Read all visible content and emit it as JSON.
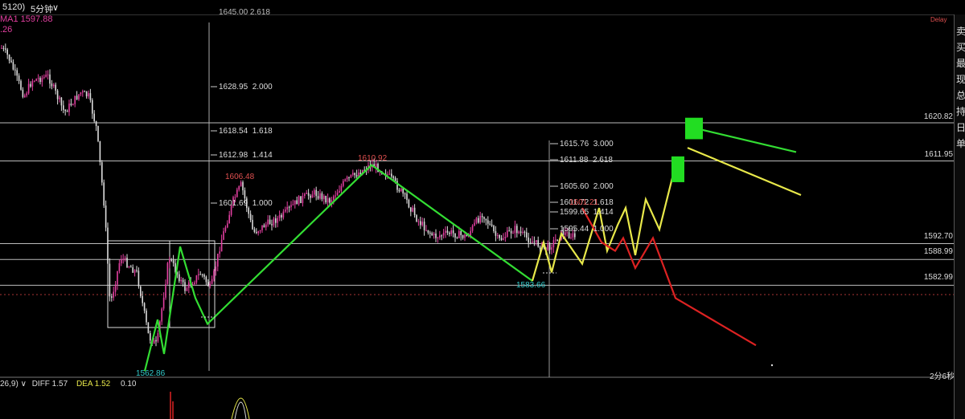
{
  "topbar": {
    "period_code": "5120)",
    "timeframe": "5分钟",
    "ma_label": "MA1 1597.88",
    "ma_label2": ".26"
  },
  "status": {
    "delay": "Delay",
    "timer": "2分6秒"
  },
  "right_panel": {
    "tabs": [
      "卖",
      "买",
      "最",
      "现",
      "总",
      "持",
      "日",
      "单"
    ]
  },
  "price_levels": [
    "1620.82",
    "1611.95",
    "1592.70",
    "1588.99",
    "1582.99"
  ],
  "fib_left": [
    {
      "price": "1628.95",
      "ratio": "2.000"
    },
    {
      "price": "1618.54",
      "ratio": "1.618"
    },
    {
      "price": "1612.98",
      "ratio": "1.414"
    },
    {
      "price": "1601.69",
      "ratio": "1.000"
    }
  ],
  "fib_right": [
    {
      "price": "1615.76",
      "ratio": "3.000"
    },
    {
      "price": "1611.88",
      "ratio": "2.618"
    },
    {
      "price": "1605.60",
      "ratio": "2.000"
    },
    {
      "price": "1601.72",
      "ratio": "1.618"
    },
    {
      "price": "1599.65",
      "ratio": "1.414"
    },
    {
      "price": "1595.44",
      "ratio": "1.000"
    }
  ],
  "fib_top_partial": "1645.00  2.618",
  "peak_labels": {
    "low1": "1562.86",
    "high1": "1606.48",
    "high2": "1610.92",
    "low2": "1583.66",
    "high3": "1601.21"
  },
  "macd": {
    "params": "26,9)",
    "diff_label": "DIFF 1.57",
    "dea_label": "DEA 1.52",
    "value": "0.10"
  },
  "chart_data": {
    "type": "line",
    "title": "",
    "xlabel": "",
    "ylabel": "",
    "ylim": [
      1556,
      1650
    ],
    "horizontal_levels": [
      1620.82,
      1611.95,
      1592.7,
      1588.99,
      1582.99
    ],
    "series": [
      {
        "color": "#33dd33",
        "points": [
          [
            0,
            1563
          ],
          [
            1,
            1575
          ],
          [
            2,
            1567
          ],
          [
            3,
            1592
          ],
          [
            4,
            1580
          ],
          [
            5,
            1574
          ],
          [
            6,
            1611
          ],
          [
            7,
            1584
          ]
        ]
      },
      {
        "color": "#e8e84a",
        "points": [
          [
            7,
            1584
          ],
          [
            8,
            1593
          ],
          [
            9,
            1586
          ],
          [
            10,
            1595
          ],
          [
            11,
            1588
          ],
          [
            12,
            1601
          ],
          [
            13,
            1591
          ],
          [
            14,
            1597
          ],
          [
            15,
            1601
          ],
          [
            16,
            1590
          ],
          [
            17,
            1603
          ],
          [
            18,
            1596
          ],
          [
            19,
            1608
          ],
          [
            20,
            1612
          ]
        ]
      },
      {
        "color": "#33dd33",
        "points": [
          [
            20,
            1620
          ],
          [
            21,
            1614
          ]
        ]
      },
      {
        "color": "#e8e84a",
        "points": [
          [
            20,
            1615
          ],
          [
            21,
            1604
          ]
        ]
      },
      {
        "color": "#dd2222",
        "points": [
          [
            12,
            1601
          ],
          [
            13,
            1593
          ],
          [
            14,
            1591
          ],
          [
            15,
            1594
          ],
          [
            16,
            1587
          ],
          [
            17,
            1594
          ],
          [
            18,
            1580
          ],
          [
            19,
            1569
          ]
        ]
      }
    ],
    "projection_boxes": [
      {
        "color": "#22dd22",
        "low": 1607,
        "high": 1613
      },
      {
        "color": "#22dd22",
        "low": 1617,
        "high": 1622
      }
    ]
  },
  "colors": {
    "candle_up": "#e23fa0",
    "candle_down": "#dddddd",
    "green": "#33dd33",
    "yellow": "#e8e84a",
    "red": "#dd2222",
    "price_high": "#e05050",
    "price_low": "#33cccc"
  }
}
